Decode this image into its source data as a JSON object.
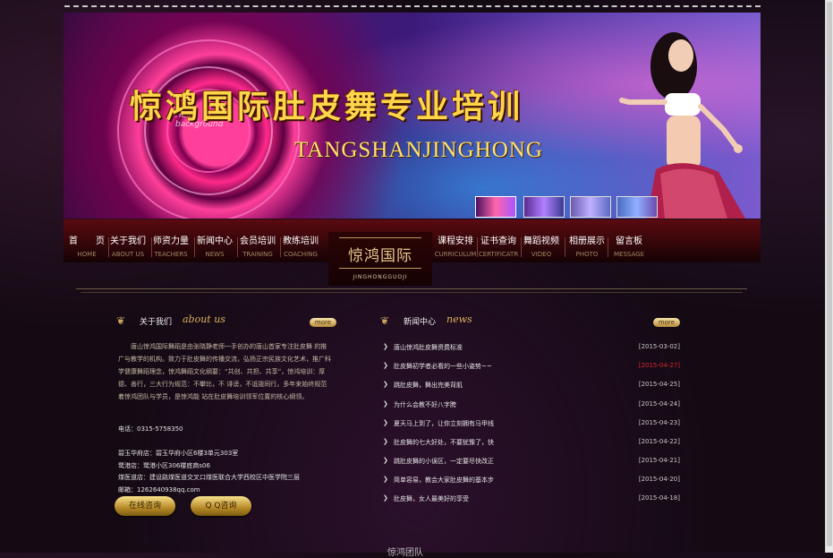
{
  "banner": {
    "title": "惊鸿国际肚皮舞专业培训",
    "subtitle": "TANGSHANJINGHONG",
    "thumbnails": 4
  },
  "nav": {
    "items": [
      {
        "cn": "首　　页",
        "en": "HOME"
      },
      {
        "cn": "关于我们",
        "en": "ABOUT US"
      },
      {
        "cn": "师资力量",
        "en": "TEACHERS"
      },
      {
        "cn": "新闻中心",
        "en": "NEWS"
      },
      {
        "cn": "会员培训",
        "en": "TRAINING"
      },
      {
        "cn": "教练培训",
        "en": "COACHING"
      },
      {
        "cn": "课程安排",
        "en": "CURRICULUM"
      },
      {
        "cn": "证书查询",
        "en": "CERTIFICATR"
      },
      {
        "cn": "舞蹈视频",
        "en": "VIDEO"
      },
      {
        "cn": "相册展示",
        "en": "PHOTO"
      },
      {
        "cn": "留言板",
        "en": "MESSAGE"
      }
    ],
    "logo_cn": "惊鸿国际",
    "logo_en": "JINGHONGGUOJI"
  },
  "about": {
    "heading_cn": "关于我们",
    "heading_en": "about us",
    "more": "more",
    "text": "　　唐山惊鸿国际舞蹈是由张晓静老师一手创办的唐山首家专注肚皮舞 的推广与教学的机构。致力于肚皮舞的传播交流，弘扬正宗民族文化艺术，推广科学健康舞蹈理念，惊鸿舞蹈文化纲要：“共创、共担、共享”，惊鸿培训：厚德、善行，三大行为规范：不攀比，不 诽谤，不诋毁同行。多年来始终规范着惊鸿团队与学员，是惊鸿能 站在肚皮舞培训领军位置的核心纲领。",
    "phone": "电话：0315-5758350",
    "addresses": [
      "碧玉华府店：碧玉华府小区6楼3单元303室",
      "鹭港店：鹭港小区306楼底商s06",
      "煤医道店：建设路煤医道交叉口煤医联合大学西校区中医学院三层"
    ],
    "email": "邮箱：1262640938qq.com",
    "online_btn": "在线咨询",
    "qq_btn": "Q Q咨询"
  },
  "news": {
    "heading_cn": "新闻中心",
    "heading_en": "news",
    "more": "more",
    "items": [
      {
        "title": "唐山惊鸿肚皮舞资费标准",
        "date": "[2015-03-02]",
        "red": false
      },
      {
        "title": "肚皮舞初学者必看的一些小姿势~~",
        "date": "[2015-04-27]",
        "red": true
      },
      {
        "title": "跳肚皮舞，舞出完美背肌",
        "date": "[2015-04-25]",
        "red": false
      },
      {
        "title": "为什么会教不好八字胯",
        "date": "[2015-04-24]",
        "red": false
      },
      {
        "title": "夏天马上到了，让你立刻拥有马甲线",
        "date": "[2015-04-23]",
        "red": false
      },
      {
        "title": "肚皮舞的七大好处，不要犹豫了，快",
        "date": "[2015-04-22]",
        "red": false
      },
      {
        "title": "跳肚皮舞的小误区，一定要尽快改正",
        "date": "[2015-04-21]",
        "red": false
      },
      {
        "title": "简单容易，教会大家肚皮舞的基本步",
        "date": "[2015-04-20]",
        "red": false
      },
      {
        "title": "肚皮舞，女人最美好的享受",
        "date": "[2015-04-18]",
        "red": false
      }
    ]
  },
  "bottom": {
    "title": "惊鸿团队"
  },
  "colors": {
    "gold": "#d9b25f",
    "nav_bg": "#5a0a10",
    "red_date": "#d8262a"
  }
}
